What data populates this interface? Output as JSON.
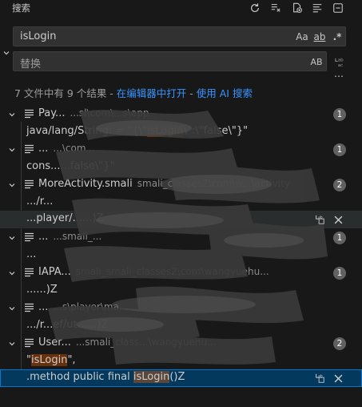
{
  "header": {
    "title": "搜索",
    "icons": [
      "refresh-icon",
      "clear-results-icon",
      "new-search-editor-icon",
      "view-as-tree-icon",
      "collapse-all-icon"
    ]
  },
  "search": {
    "value": "isLogin",
    "match_case_label": "Aa",
    "whole_word_label": "ab",
    "regex_label": ".*"
  },
  "replace": {
    "placeholder": "替换",
    "preserve_case_label": "AB"
  },
  "summary": {
    "text": "7 文件中有 9 个结果 - ",
    "open_in_editor": "在编辑器中打开",
    "separator": " - ",
    "ai_search": "使用 AI 搜索"
  },
  "files": [
    {
      "name": "Pay...",
      "path": "...sl\\com\\...s\\app",
      "count": "1"
    },
    {
      "name": "...",
      "path": "...\\com...",
      "count": "1"
    },
    {
      "name": "MoreActivity.smali",
      "path": "smali_classes2\\com\\w...\\activity",
      "count": "2"
    },
    {
      "name": "...",
      "path": "...smali_...",
      "count": "1"
    },
    {
      "name": "IAPA...",
      "path": "smali_smali_classes2\\com\\wangyuehu...",
      "count": "1"
    },
    {
      "name": "...",
      "path": "...s\\player\\ma...",
      "count": "1"
    },
    {
      "name": "User...",
      "path": "...smali_class...\\wangyuehu...",
      "count": "2"
    }
  ],
  "matches": [
    {
      "pre": "java/lang/String; = \"{\\\"",
      "hit": "isLogin",
      "post": "\\\":\\\"false\\\"}\""
    },
    {
      "pre": "cons...",
      "hit": "",
      "post": "...false\\\"}\""
    },
    {
      "pre": ".../r...",
      "hit": "",
      "post": ""
    },
    {
      "pre": "...player/...",
      "hit": "",
      "post": "...)Z"
    },
    {
      "pre": "...",
      "hit": "",
      "post": ""
    },
    {
      "pre": "...",
      "hit": "",
      "post": "...)Z"
    },
    {
      "pre": ".../r...ef/ut...",
      "hit": "",
      "post": "...)Z"
    },
    {
      "pre": "\"",
      "hit": "isLogin",
      "post": "\","
    },
    {
      "pre": ".method public final ",
      "hit": "isLogin",
      "post": "()Z"
    }
  ]
}
